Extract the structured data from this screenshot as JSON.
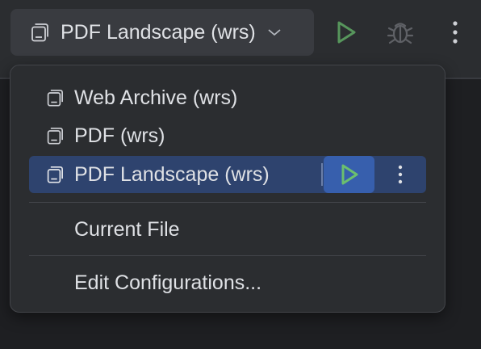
{
  "toolbar": {
    "run_config": {
      "label": "PDF Landscape (wrs)",
      "icon": "run-configuration-icon"
    },
    "buttons": {
      "run": {
        "icon": "run-icon",
        "color": "#57965c"
      },
      "debug": {
        "icon": "debug-icon"
      },
      "more": {
        "icon": "more-vertical-icon"
      }
    }
  },
  "popup": {
    "configurations": [
      {
        "label": "Web Archive (wrs)",
        "icon": "run-configuration-icon"
      },
      {
        "label": "PDF (wrs)",
        "icon": "run-configuration-icon"
      },
      {
        "label": "PDF Landscape (wrs)",
        "icon": "run-configuration-icon",
        "selected": true
      }
    ],
    "actions": {
      "current_file": "Current File",
      "edit_configurations": "Edit Configurations..."
    }
  },
  "colors": {
    "background": "#2b2d30",
    "editor": "#1e1f22",
    "selection": "#2e436e",
    "selection_run": "#375fad",
    "run_green": "#57965c"
  }
}
